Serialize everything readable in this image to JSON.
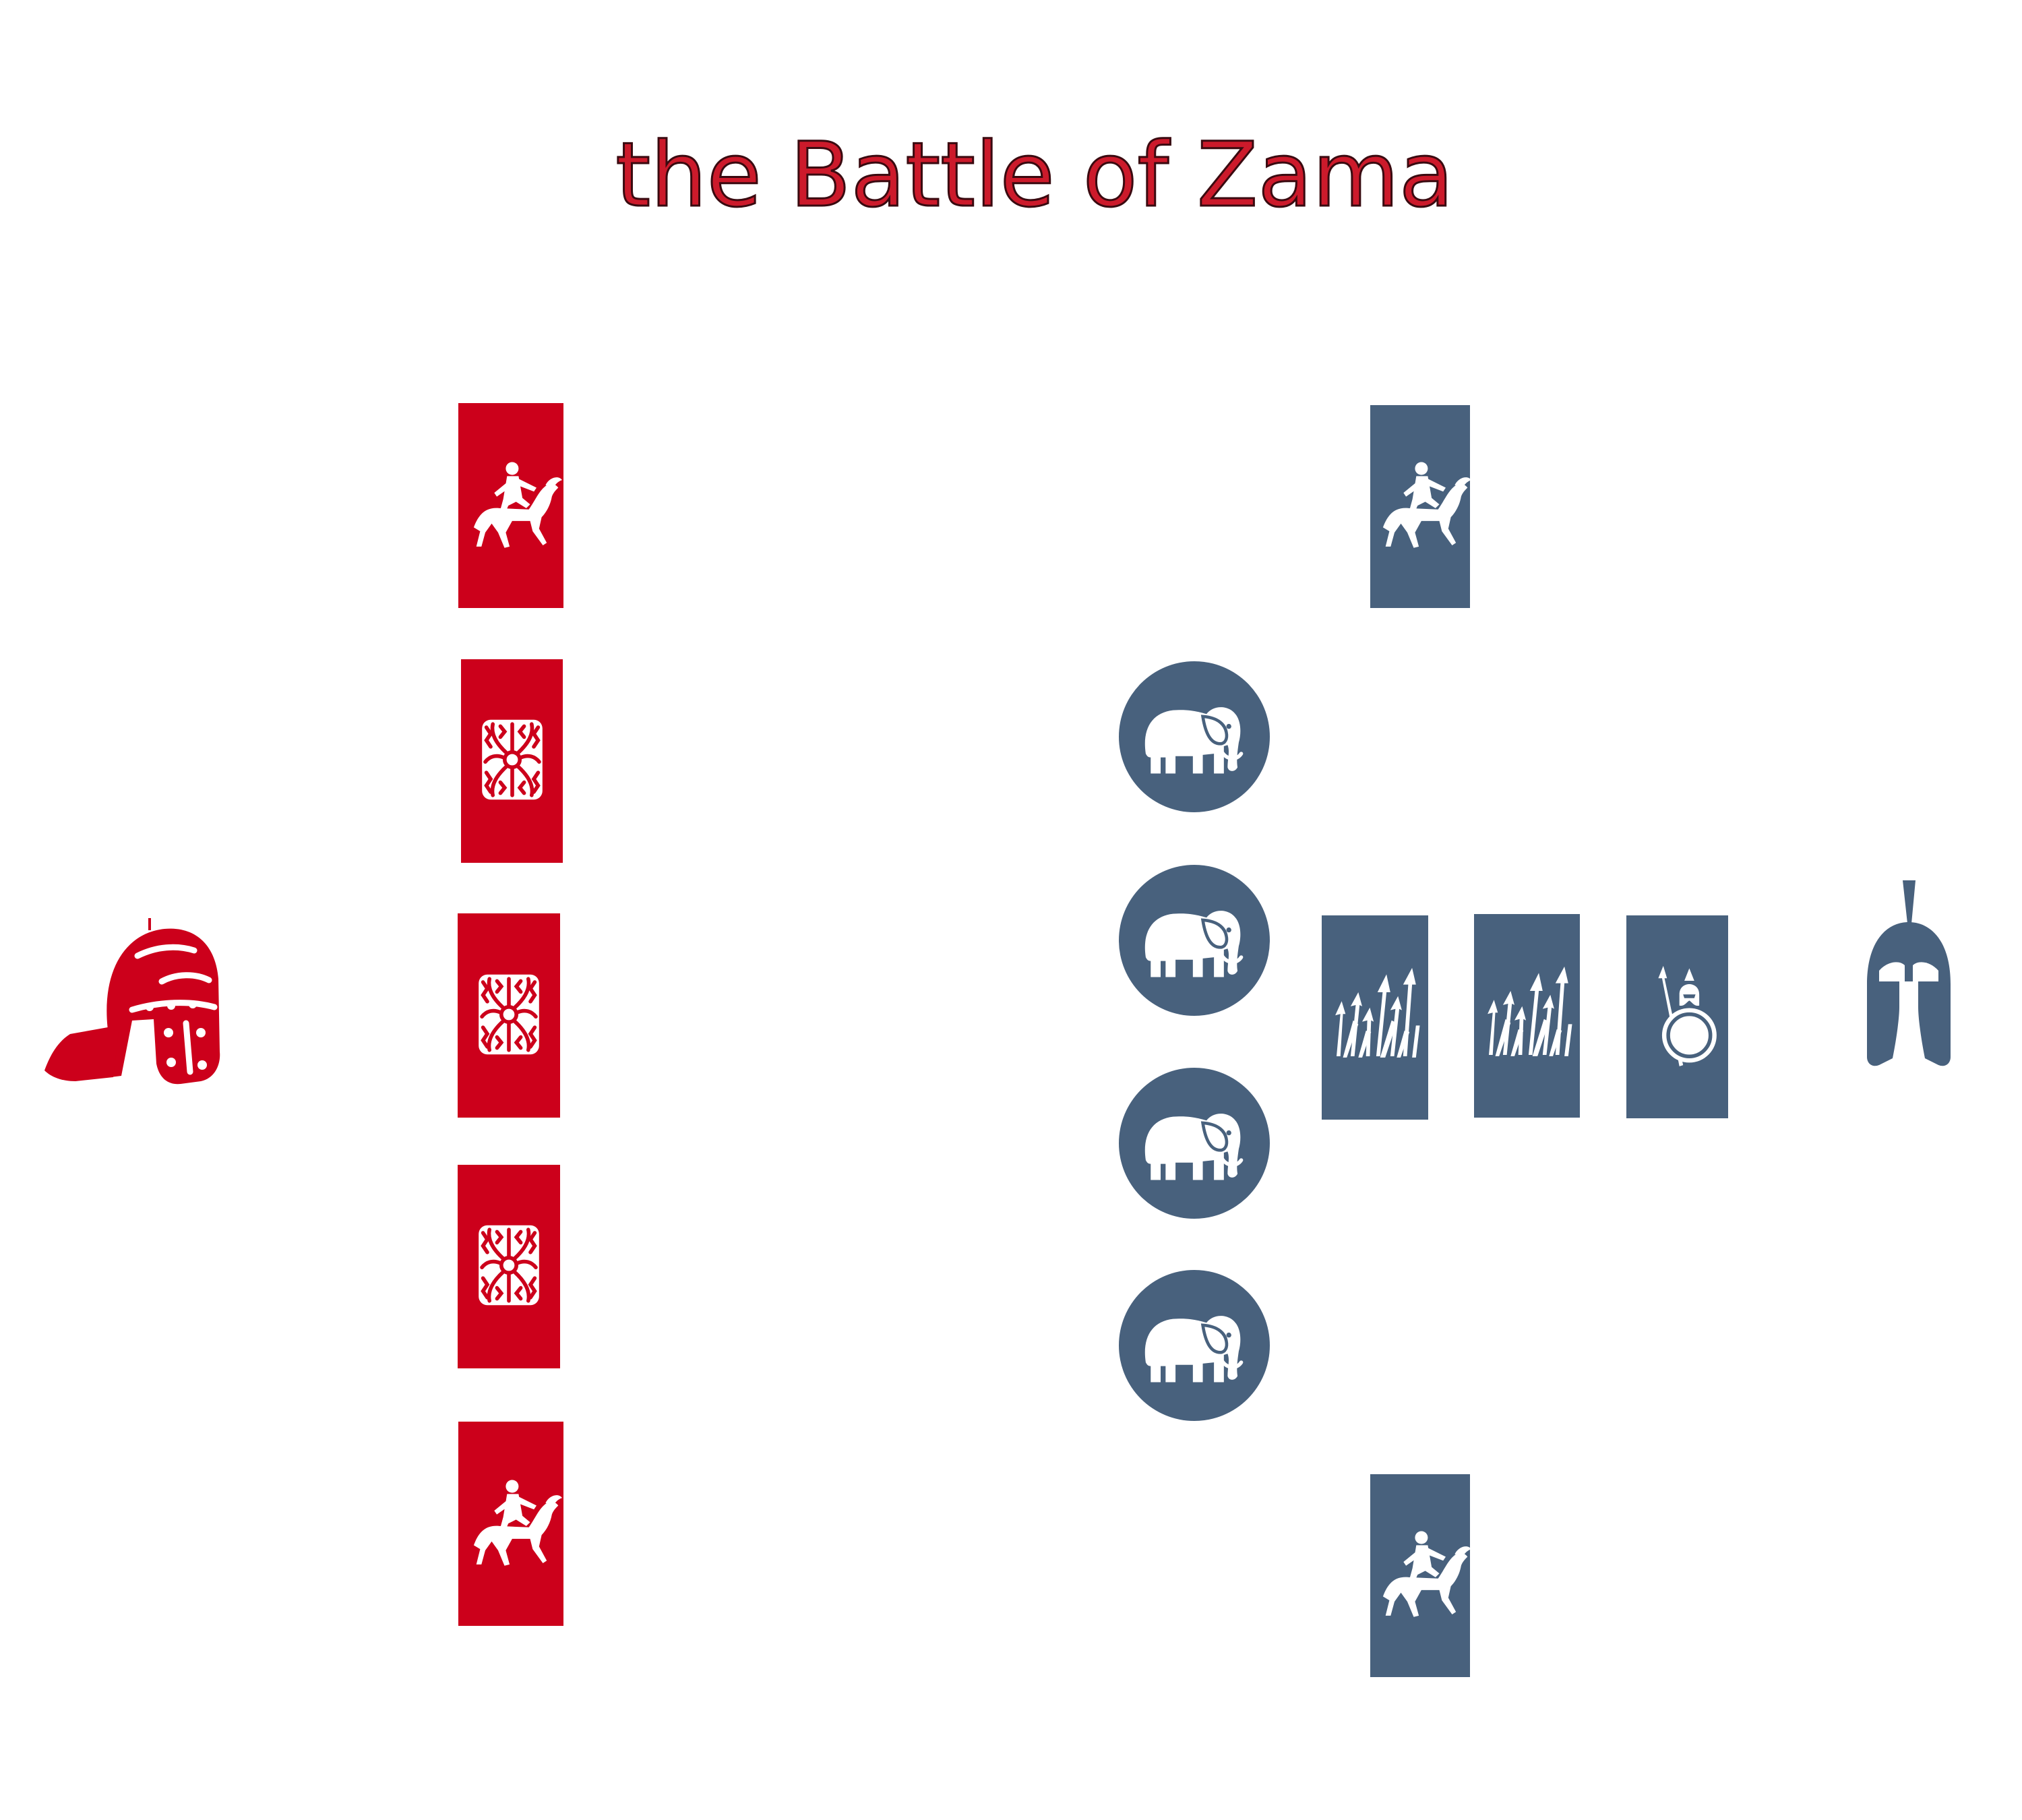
{
  "title": "the Battle of Zama",
  "colors": {
    "roman": "#cc001b",
    "carthage": "#48617d",
    "icon_fill": "#ffffff",
    "title_fill": "#cc1a2b",
    "title_outline": "#3a0a10"
  },
  "roman_army": {
    "commander_icon": "roman-helmet-icon",
    "units": [
      {
        "id": "roman-cavalry-top",
        "type": "cavalry",
        "icon": "horseman-icon"
      },
      {
        "id": "roman-infantry-1",
        "type": "infantry",
        "icon": "scutum-shield-icon"
      },
      {
        "id": "roman-infantry-2",
        "type": "infantry",
        "icon": "scutum-shield-icon"
      },
      {
        "id": "roman-infantry-3",
        "type": "infantry",
        "icon": "scutum-shield-icon"
      },
      {
        "id": "roman-cavalry-bottom",
        "type": "cavalry",
        "icon": "horseman-icon"
      }
    ]
  },
  "carthaginian_army": {
    "commander_icon": "greek-helmet-icon",
    "units": [
      {
        "id": "carthage-cavalry-top",
        "type": "cavalry",
        "icon": "horseman-icon"
      },
      {
        "id": "carthage-elephant-1",
        "type": "elephant",
        "icon": "elephant-icon"
      },
      {
        "id": "carthage-elephant-2",
        "type": "elephant",
        "icon": "elephant-icon"
      },
      {
        "id": "carthage-elephant-3",
        "type": "elephant",
        "icon": "elephant-icon"
      },
      {
        "id": "carthage-elephant-4",
        "type": "elephant",
        "icon": "elephant-icon"
      },
      {
        "id": "carthage-infantry-1",
        "type": "spearmen",
        "icon": "spears-icon"
      },
      {
        "id": "carthage-infantry-2",
        "type": "spearmen",
        "icon": "spears-icon"
      },
      {
        "id": "carthage-veterans",
        "type": "veterans",
        "icon": "spear-and-shield-icon"
      },
      {
        "id": "carthage-cavalry-bottom",
        "type": "cavalry",
        "icon": "horseman-icon"
      }
    ]
  }
}
